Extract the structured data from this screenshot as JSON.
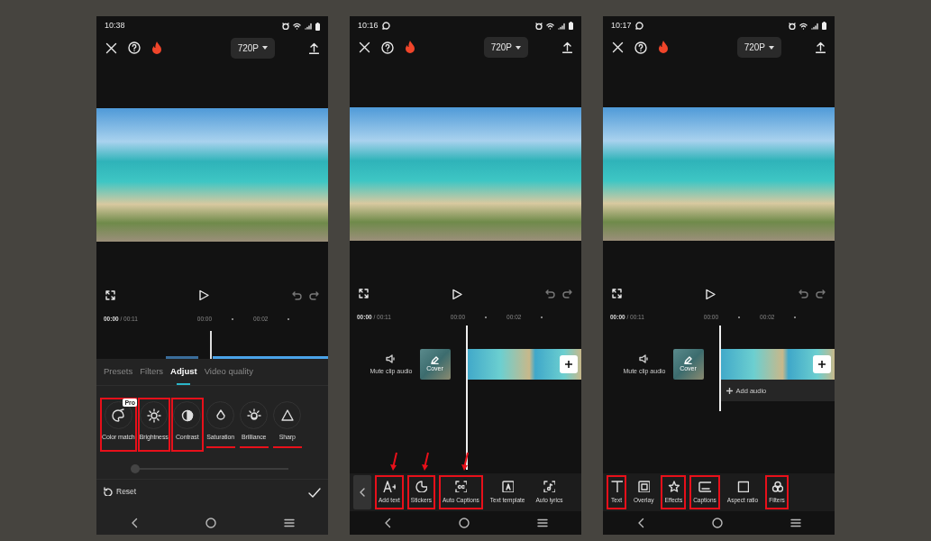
{
  "phones": [
    {
      "kind": "adjust",
      "status_time": "10:38",
      "chat_notification": false,
      "quality": "720P",
      "time": "**00:00** / 00:11",
      "ruler": [
        "00:00",
        "00:02"
      ],
      "tabs": [
        {
          "label": "Presets",
          "selected": false
        },
        {
          "label": "Filters",
          "selected": false
        },
        {
          "label": "Adjust",
          "selected": true
        },
        {
          "label": "Video quality",
          "selected": false
        }
      ],
      "tools": [
        {
          "label": "Color match",
          "badge": "Pro",
          "highlighted": true,
          "underlined": false
        },
        {
          "label": "Brightness",
          "highlighted": true,
          "underlined": false
        },
        {
          "label": "Contrast",
          "highlighted": true,
          "underlined": false
        },
        {
          "label": "Saturation",
          "highlighted": false,
          "underlined": true
        },
        {
          "label": "Brilliance",
          "highlighted": false,
          "underlined": true
        },
        {
          "label": "Sharp",
          "highlighted": false,
          "underlined": true
        }
      ],
      "slider": {
        "level": 0
      },
      "reset": "Reset"
    },
    {
      "kind": "timeline",
      "status_time": "10:16",
      "chat_notification": true,
      "quality": "720P",
      "time": "**00:00** / 00:11",
      "ruler": [
        "00:00",
        "00:02"
      ],
      "mute_label": "Mute clip audio",
      "cover_label": "Cover",
      "back_button": true,
      "tools": [
        {
          "label": "Add text",
          "highlighted": true,
          "arrow": true
        },
        {
          "label": "Stickers",
          "highlighted": true,
          "arrow": true
        },
        {
          "label": "Auto Captions",
          "highlighted": true,
          "arrow": true
        },
        {
          "label": "Text template",
          "highlighted": false,
          "arrow": false
        },
        {
          "label": "Auto lyrics",
          "highlighted": false,
          "arrow": false
        }
      ]
    },
    {
      "kind": "timeline",
      "status_time": "10:17",
      "chat_notification": true,
      "quality": "720P",
      "time": "**00:00** / 00:11",
      "ruler": [
        "00:00",
        "00:02"
      ],
      "mute_label": "Mute clip audio",
      "cover_label": "Cover",
      "add_audio": "Add audio",
      "back_button": false,
      "tools": [
        {
          "label": "Text",
          "highlighted": true,
          "arrow": false
        },
        {
          "label": "Overlay",
          "highlighted": false,
          "arrow": false
        },
        {
          "label": "Effects",
          "highlighted": true,
          "arrow": false
        },
        {
          "label": "Captions",
          "highlighted": true,
          "arrow": false
        },
        {
          "label": "Aspect ratio",
          "highlighted": false,
          "arrow": false
        },
        {
          "label": "Filters",
          "highlighted": true,
          "arrow": false
        }
      ]
    }
  ]
}
